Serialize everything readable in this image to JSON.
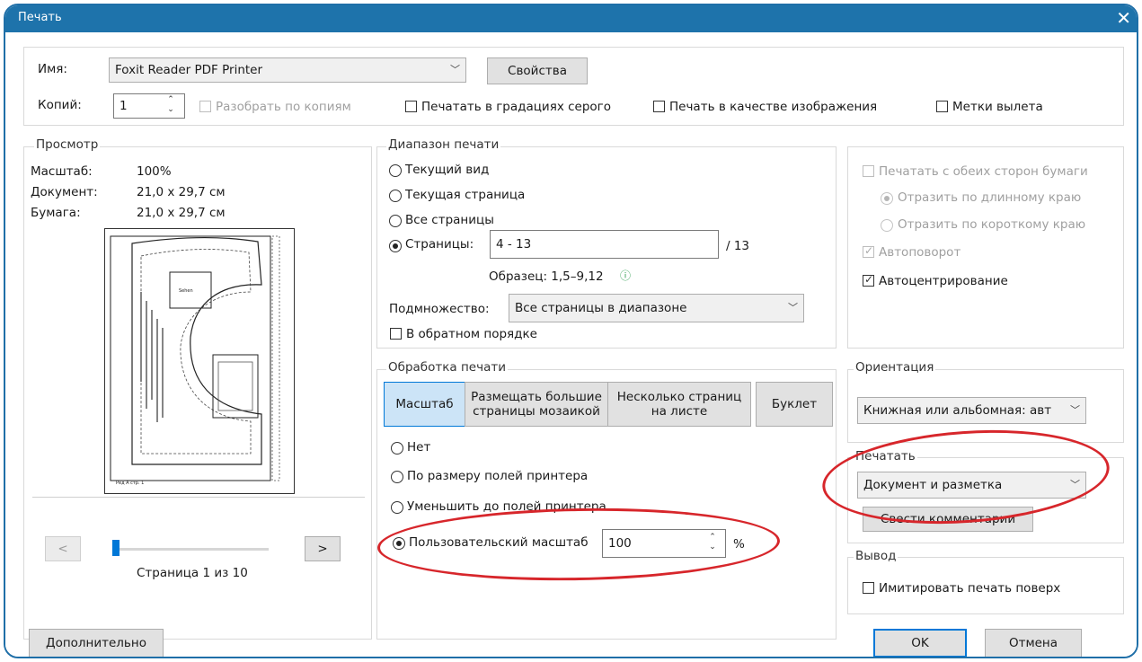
{
  "window": {
    "title": "Печать"
  },
  "printer": {
    "name_label": "Имя:",
    "name_value": "Foxit Reader PDF Printer",
    "properties_button": "Свойства"
  },
  "copies": {
    "label": "Копий:",
    "value": "1",
    "collate_label": "Разобрать по копиям"
  },
  "options": {
    "grayscale": "Печатать в градациях серого",
    "as_image": "Печать в качестве изображения",
    "bleed_marks": "Метки вылета"
  },
  "preview": {
    "title": "Просмотр",
    "scale_label": "Масштаб:",
    "scale_value": "100%",
    "document_label": "Документ:",
    "document_value": "21,0 x 29,7 см",
    "paper_label": "Бумага:",
    "paper_value": "21,0 x 29,7 см",
    "prev_button": "<",
    "next_button": ">",
    "page_indicator": "Страница 1 из 10",
    "slider_position": 0.0
  },
  "print_range": {
    "title": "Диапазон печати",
    "current_view": "Текущий вид",
    "current_page": "Текущая страница",
    "all_pages": "Все страницы",
    "pages_label": "Страницы:",
    "pages_value": "4 - 13",
    "pages_total": "/ 13",
    "example": "Образец: 1,5–9,12",
    "subset_label": "Подмножество:",
    "subset_value": "Все страницы в диапазоне",
    "reverse_order": "В обратном порядке"
  },
  "duplex": {
    "both_sides": "Печатать с обеих сторон бумаги",
    "flip_long": "Отразить по длинному краю",
    "flip_short": "Отразить по короткому краю",
    "auto_rotate": "Автоповорот",
    "auto_center": "Автоцентрирование"
  },
  "handling": {
    "title": "Обработка печати",
    "tab_scale": "Масштаб",
    "tab_tile_line1": "Размещать большие",
    "tab_tile_line2": "страницы мозаикой",
    "tab_multiple_line1": "Несколько страниц",
    "tab_multiple_line2": "на листе",
    "tab_booklet": "Буклет",
    "none": "Нет",
    "fit_printer": "По размеру полей принтера",
    "shrink_printer": "Уменьшить до полей принтера",
    "custom_scale": "Пользовательский масштаб",
    "custom_value": "100",
    "percent": "%"
  },
  "orientation": {
    "title": "Ориентация",
    "value": "Книжная или альбомная: авт"
  },
  "print_what": {
    "title": "Печатать",
    "value": "Документ и разметка",
    "summarize_button": "Свести комментарии"
  },
  "output": {
    "title": "Вывод",
    "simulate_overprint": "Имитировать печать поверх"
  },
  "footer": {
    "advanced_button": "Дополнительно",
    "ok_button": "OK",
    "cancel_button": "Отмена"
  },
  "colors": {
    "titlebar": "#1e73ab",
    "accent": "#0078d7",
    "annotation": "#d7262b"
  }
}
